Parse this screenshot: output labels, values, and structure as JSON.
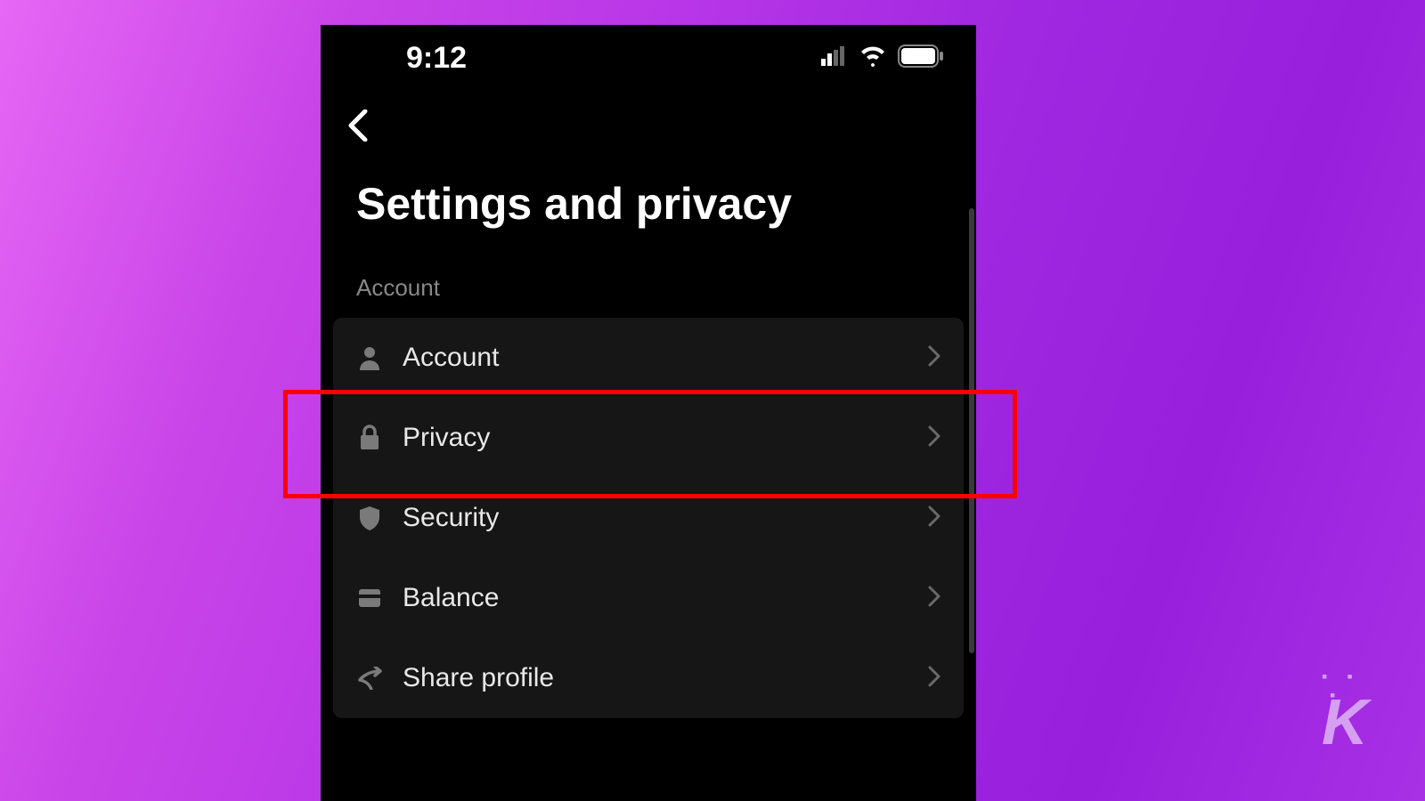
{
  "status": {
    "time": "9:12"
  },
  "page": {
    "title": "Settings and privacy",
    "section_label": "Account"
  },
  "list": {
    "items": [
      {
        "label": "Account",
        "icon": "person"
      },
      {
        "label": "Privacy",
        "icon": "lock"
      },
      {
        "label": "Security",
        "icon": "shield"
      },
      {
        "label": "Balance",
        "icon": "wallet"
      },
      {
        "label": "Share profile",
        "icon": "share"
      }
    ]
  },
  "highlighted_item_index": 1
}
